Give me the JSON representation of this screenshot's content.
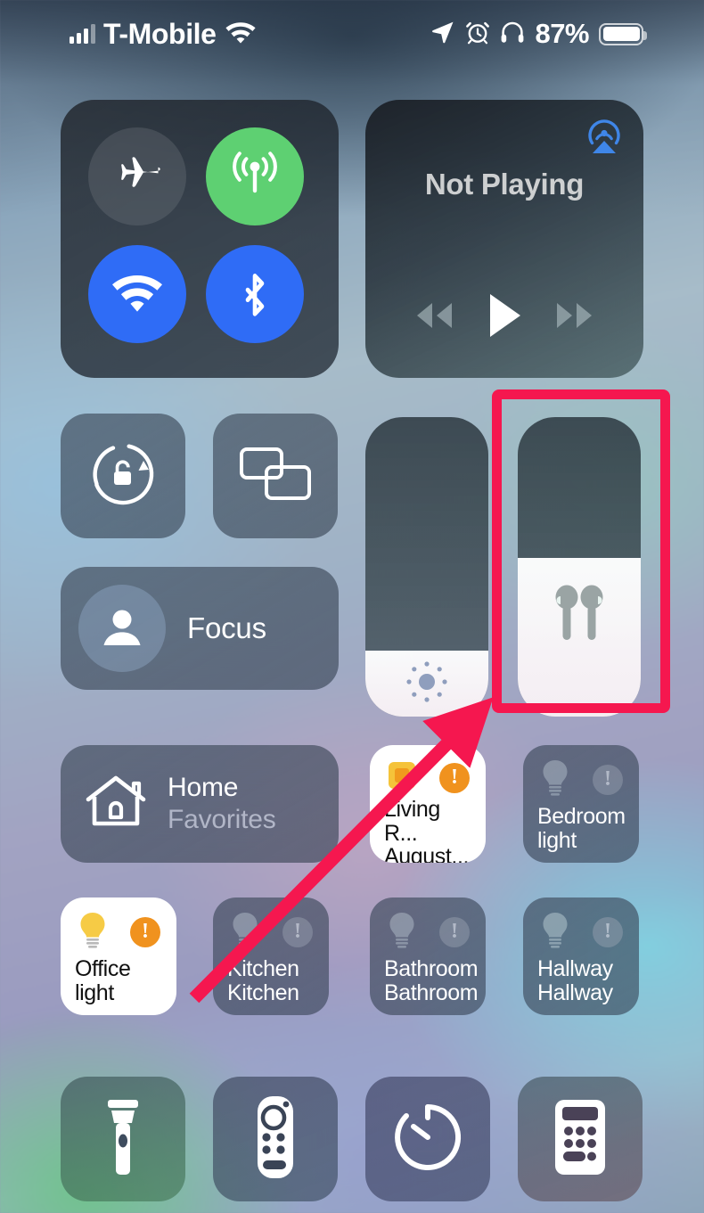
{
  "status_bar": {
    "carrier": "T-Mobile",
    "signal_icon": "cellular-bars-icon",
    "wifi_icon": "wifi-icon",
    "location_icon": "location-arrow-icon",
    "alarm_icon": "alarm-clock-icon",
    "headphones_icon": "headphones-icon",
    "battery_percent": "87%",
    "battery_icon": "battery-icon"
  },
  "connectivity": {
    "airplane": {
      "name": "airplane-mode",
      "icon": "airplane-icon",
      "state": "off",
      "color": "#6f747c"
    },
    "cellular": {
      "name": "cellular-data",
      "icon": "cellular-tower-icon",
      "state": "on",
      "color": "#5ed072"
    },
    "wifi": {
      "name": "wi-fi",
      "icon": "wifi-icon",
      "state": "on",
      "color": "#2f6cf6"
    },
    "bluetooth": {
      "name": "bluetooth",
      "icon": "bluetooth-icon",
      "state": "on",
      "color": "#2f6cf6"
    }
  },
  "media": {
    "title": "Not Playing",
    "airplay_icon": "airplay-audio-icon",
    "rewind_icon": "rewind-icon",
    "play_icon": "play-icon",
    "forward_icon": "fast-forward-icon"
  },
  "controls": {
    "rotation_lock": {
      "label": "Rotation Lock",
      "icon": "rotation-lock-open-icon",
      "state": "off"
    },
    "screen_mirroring": {
      "label": "Screen Mirroring",
      "icon": "screen-mirroring-icon",
      "state": "off"
    }
  },
  "focus": {
    "label": "Focus",
    "icon": "person-icon",
    "state": "off"
  },
  "sliders": {
    "brightness": {
      "label": "Brightness",
      "icon": "brightness-sun-icon",
      "value_percent": 22
    },
    "volume": {
      "label": "Volume",
      "icon": "airpods-icon",
      "value_percent": 53,
      "highlighted": true
    }
  },
  "home": {
    "title": "Home",
    "subtitle": "Favorites",
    "icon": "house-icon"
  },
  "accessories": [
    {
      "name": "living-room-august",
      "line1": "Living R...",
      "line2": "August...",
      "icon": "lock-square-icon",
      "state": "on",
      "badge": "warning",
      "badge_glyph": "!"
    },
    {
      "name": "bedroom-light",
      "line1": "Bedroom",
      "line2": "light",
      "icon": "lightbulb-icon",
      "state": "off",
      "badge": "muted",
      "badge_glyph": "!"
    },
    {
      "name": "office-light",
      "line1": "Office",
      "line2": "light",
      "icon": "lightbulb-icon",
      "state": "on",
      "badge": "warning",
      "badge_glyph": "!"
    },
    {
      "name": "kitchen-light",
      "line1": "Kitchen",
      "line2": "Kitchen",
      "icon": "lightbulb-icon",
      "state": "off",
      "badge": "muted",
      "badge_glyph": "!"
    },
    {
      "name": "bathroom-light",
      "line1": "Bathroom",
      "line2": "Bathroom",
      "icon": "lightbulb-icon",
      "state": "off",
      "badge": "muted",
      "badge_glyph": "!"
    },
    {
      "name": "hallway-light",
      "line1": "Hallway",
      "line2": "Hallway",
      "icon": "lightbulb-icon",
      "state": "off",
      "badge": "muted",
      "badge_glyph": "!"
    }
  ],
  "utilities": [
    {
      "name": "flashlight",
      "label": "Flashlight",
      "icon": "flashlight-icon"
    },
    {
      "name": "apple-tv-remote",
      "label": "Apple TV Remote",
      "icon": "remote-control-icon"
    },
    {
      "name": "timer",
      "label": "Timer",
      "icon": "timer-icon"
    },
    {
      "name": "calculator",
      "label": "Calculator",
      "icon": "calculator-icon"
    }
  ],
  "annotations": {
    "highlight_color": "#f5174f",
    "highlight_target": "volume-slider",
    "arrow_color": "#f5174f",
    "arrow_points_to": "volume-slider"
  }
}
